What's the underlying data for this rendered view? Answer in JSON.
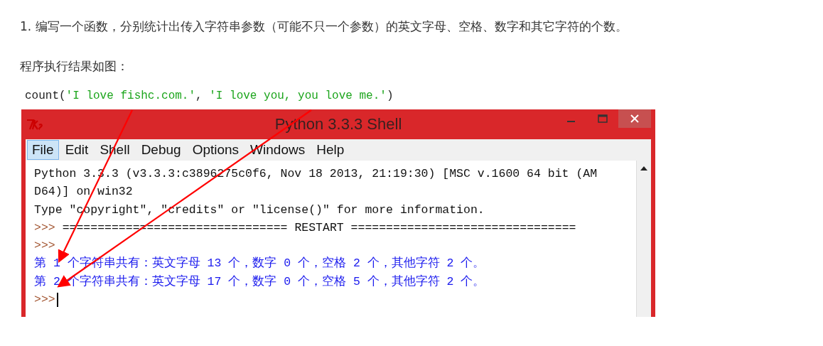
{
  "question": "1. 编写一个函数，分别统计出传入字符串参数（可能不只一个参数）的英文字母、空格、数字和其它字符的个数。",
  "caption": "程序执行结果如图：",
  "code_line": [
    {
      "kind": "plain",
      "text": "count("
    },
    {
      "kind": "string",
      "text": "'I love fishc.com.'"
    },
    {
      "kind": "plain",
      "text": ", "
    },
    {
      "kind": "string",
      "text": "'I love you, you love me.'"
    },
    {
      "kind": "plain",
      "text": ")"
    }
  ],
  "shell": {
    "title": "Python 3.3.3 Shell",
    "menu": [
      {
        "label": "File",
        "selected": true
      },
      {
        "label": "Edit",
        "selected": false
      },
      {
        "label": "Shell",
        "selected": false
      },
      {
        "label": "Debug",
        "selected": false
      },
      {
        "label": "Options",
        "selected": false
      },
      {
        "label": "Windows",
        "selected": false
      },
      {
        "label": "Help",
        "selected": false
      }
    ],
    "lines": [
      {
        "kind": "text",
        "text": "Python 3.3.3 (v3.3.3:c3896275c0f6, Nov 18 2013, 21:19:30) [MSC v.1600 64 bit (AM"
      },
      {
        "kind": "text",
        "text": "D64)] on win32"
      },
      {
        "kind": "text",
        "text": "Type \"copyright\", \"credits\" or \"license()\" for more information."
      },
      {
        "kind": "prompt",
        "prompt": ">>>",
        "text": "================================ RESTART ================================"
      },
      {
        "kind": "prompt",
        "prompt": ">>>"
      },
      {
        "kind": "output",
        "text": "第 1 个字符串共有：英文字母 13 个，数字 0 个，空格 2 个，其他字符 2 个。"
      },
      {
        "kind": "output",
        "text": "第 2 个字符串共有：英文字母 17 个，数字 0 个，空格 5 个，其他字符 2 个。"
      },
      {
        "kind": "prompt",
        "prompt": ">>>",
        "cursor": true
      }
    ]
  }
}
